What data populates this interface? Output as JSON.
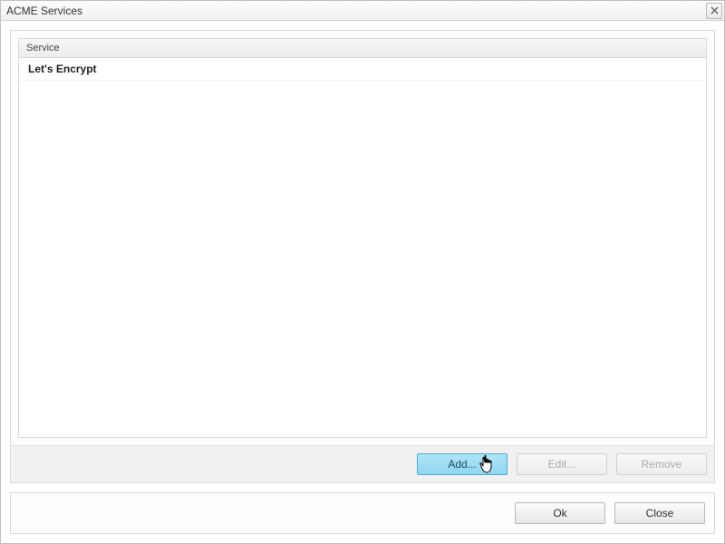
{
  "window": {
    "title": "ACME Services"
  },
  "table": {
    "header": "Service",
    "rows": [
      {
        "name": "Let's Encrypt"
      }
    ]
  },
  "panelButtons": {
    "add": "Add...",
    "edit": "Edit...",
    "remove": "Remove"
  },
  "footerButtons": {
    "ok": "Ok",
    "close": "Close"
  }
}
